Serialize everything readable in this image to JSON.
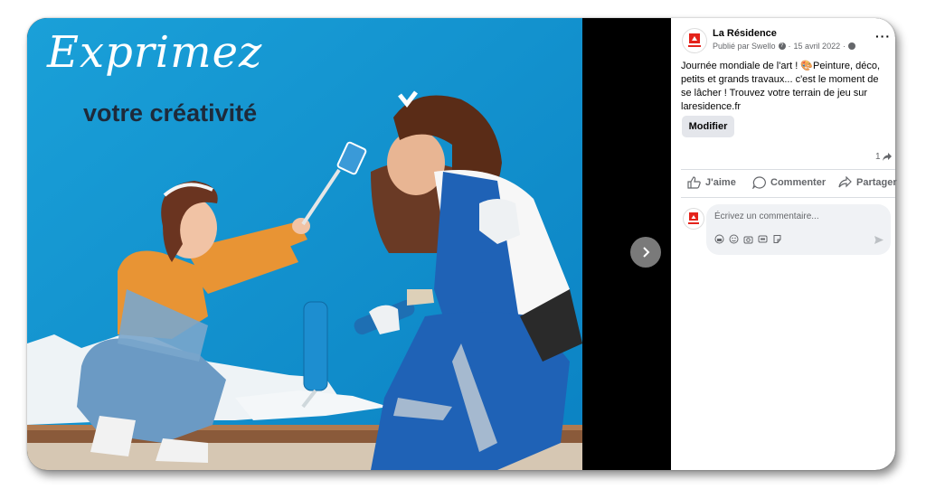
{
  "photo": {
    "headline_script": "Exprimez",
    "headline_bold": "votre créativité"
  },
  "viewer": {
    "next_icon": "chevron-right-icon"
  },
  "post": {
    "page_name": "La Résidence",
    "published_by": "Publié par Swello",
    "date": "15 avril 2022",
    "text": "Journée mondiale de l'art ! 🎨Peinture, déco, petits et grands travaux... c'est le moment de se lâcher ! Trouvez votre terrain de jeu sur laresidence.fr",
    "edit_label": "Modifier",
    "share_count": "1",
    "actions": {
      "like": "J'aime",
      "comment": "Commenter",
      "share": "Partager"
    },
    "comment_placeholder": "Écrivez un commentaire...",
    "brand_color": "#e4231b"
  }
}
